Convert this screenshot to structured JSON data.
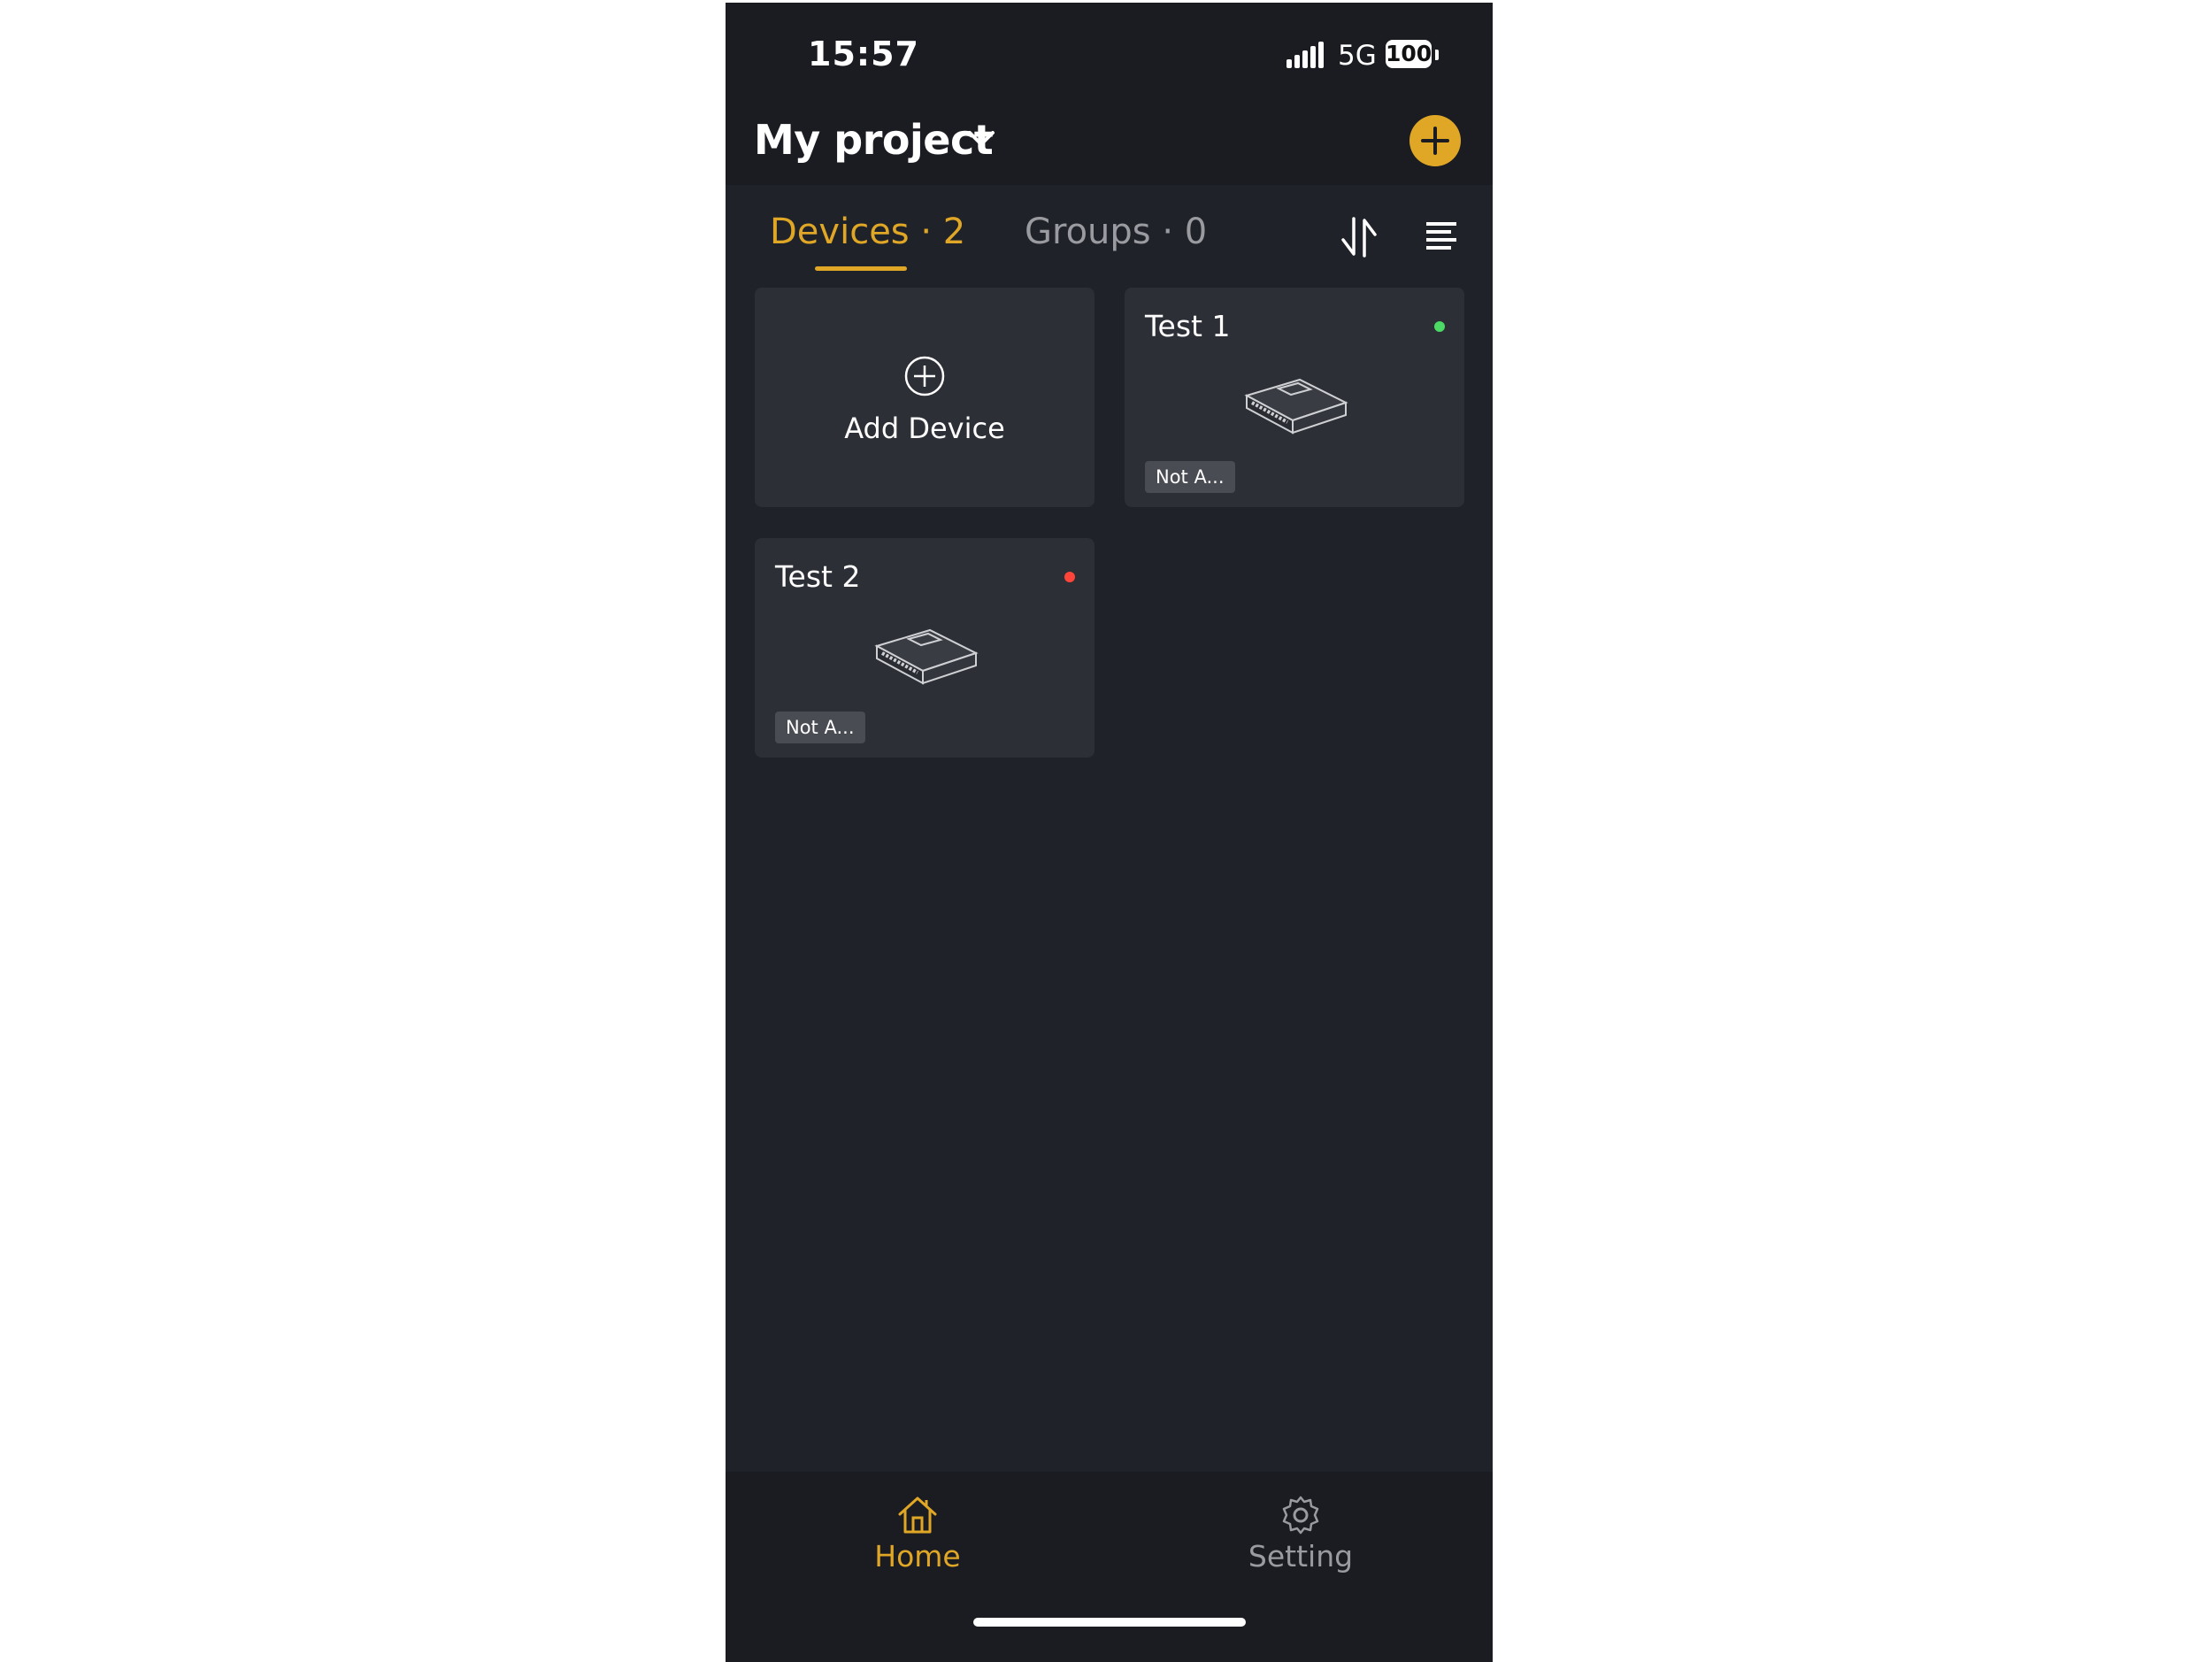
{
  "status_bar": {
    "time": "15:57",
    "network": "5G",
    "battery": "100"
  },
  "header": {
    "project_title": "My project"
  },
  "tabs": [
    {
      "label": "Devices · 2",
      "active": true
    },
    {
      "label": "Groups · 0",
      "active": false
    }
  ],
  "add_card": {
    "label": "Add Device"
  },
  "devices": [
    {
      "name": "Test 1",
      "status_color": "#4cd964",
      "badge": "Not A..."
    },
    {
      "name": "Test 2",
      "status_color": "#ff453a",
      "badge": "Not A..."
    }
  ],
  "bottom_nav": [
    {
      "label": "Home",
      "icon": "home-icon",
      "active": true
    },
    {
      "label": "Setting",
      "icon": "gear-icon",
      "active": false
    }
  ],
  "colors": {
    "accent": "#e0a726",
    "background": "#20222a",
    "card": "#2d2f37"
  }
}
